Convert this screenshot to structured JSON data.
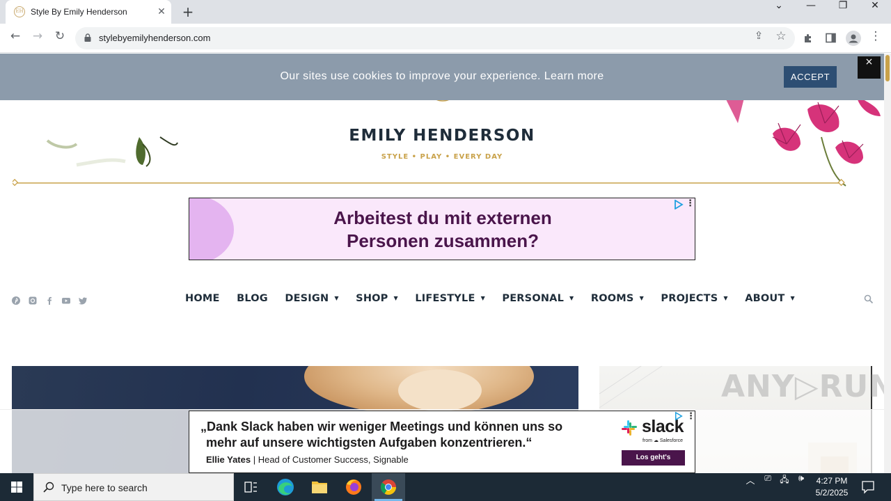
{
  "browser": {
    "tab_title": "Style By Emily Henderson",
    "tab_favicon_text": "EH",
    "url": "stylebyemilyhenderson.com"
  },
  "cookie_bar": {
    "message": "Our sites use cookies to improve your experience. Learn more",
    "accept_label": "ACCEPT",
    "close_label": "×"
  },
  "site": {
    "logo_monogram": "EH",
    "brand": "EMILY HENDERSON",
    "tagline": "STYLE  •  PLAY  •  EVERY DAY"
  },
  "ad_top": {
    "line1": "Arbeitest du mit externen",
    "line2": "Personen zusammen?"
  },
  "social_icons": [
    "pinterest-icon",
    "instagram-icon",
    "facebook-icon",
    "youtube-icon",
    "twitter-icon"
  ],
  "nav": {
    "items": [
      {
        "label": "HOME",
        "dropdown": false
      },
      {
        "label": "BLOG",
        "dropdown": false
      },
      {
        "label": "DESIGN",
        "dropdown": true
      },
      {
        "label": "SHOP",
        "dropdown": true
      },
      {
        "label": "LIFESTYLE",
        "dropdown": true
      },
      {
        "label": "PERSONAL",
        "dropdown": true
      },
      {
        "label": "ROOMS",
        "dropdown": true
      },
      {
        "label": "PROJECTS",
        "dropdown": true
      },
      {
        "label": "ABOUT",
        "dropdown": true
      }
    ]
  },
  "ad_bottom": {
    "quote_line1": "„Dank Slack haben wir weniger Meetings und können uns so",
    "quote_line2": "mehr auf unsere wichtigsten Aufgaben konzentrieren.“",
    "author_name": "Ellie Yates",
    "author_role": " | Head of Customer Success, Signable",
    "logo_word": "slack",
    "logo_from": "from ☁ Salesforce",
    "cta": "Los geht's"
  },
  "watermark": "ANY▷RUN",
  "taskbar": {
    "search_placeholder": "Type here to search",
    "time": "4:27 PM",
    "date": "5/2/2025"
  },
  "colors": {
    "cookie_bg": "#8c9bab",
    "accept_bg": "#2d4e73",
    "gold": "#c9a24a",
    "navy": "#1f2d3a",
    "slack_purple": "#4a154b"
  }
}
